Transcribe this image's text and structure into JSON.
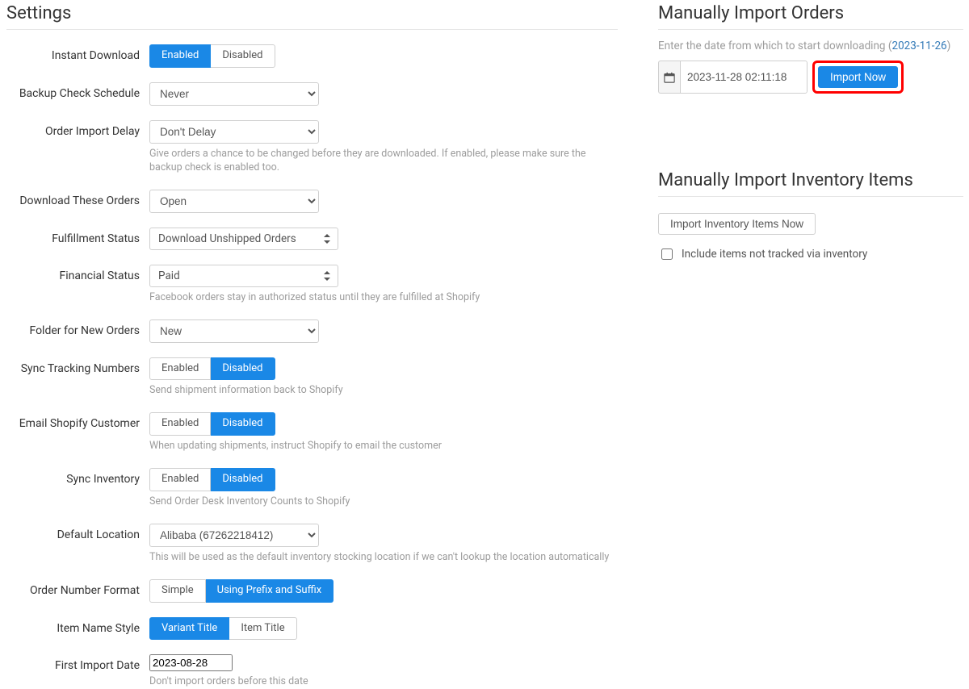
{
  "left": {
    "heading": "Settings",
    "rows": {
      "instant_download": {
        "label": "Instant Download",
        "options": [
          "Enabled",
          "Disabled"
        ],
        "active": 0
      },
      "backup_check": {
        "label": "Backup Check Schedule",
        "value": "Never"
      },
      "order_import_delay": {
        "label": "Order Import Delay",
        "value": "Don't Delay",
        "help": "Give orders a chance to be changed before they are downloaded. If enabled, please make sure the backup check is enabled too."
      },
      "download_these": {
        "label": "Download These Orders",
        "value": "Open"
      },
      "fulfillment": {
        "label": "Fulfillment Status",
        "value": "Download Unshipped Orders"
      },
      "financial": {
        "label": "Financial Status",
        "value": "Paid",
        "help": "Facebook orders stay in authorized status until they are fulfilled at Shopify"
      },
      "folder_new": {
        "label": "Folder for New Orders",
        "value": "New"
      },
      "sync_tracking": {
        "label": "Sync Tracking Numbers",
        "options": [
          "Enabled",
          "Disabled"
        ],
        "active": 1,
        "help": "Send shipment information back to Shopify"
      },
      "email_customer": {
        "label": "Email Shopify Customer",
        "options": [
          "Enabled",
          "Disabled"
        ],
        "active": 1,
        "help": "When updating shipments, instruct Shopify to email the customer"
      },
      "sync_inventory": {
        "label": "Sync Inventory",
        "options": [
          "Enabled",
          "Disabled"
        ],
        "active": 1,
        "help": "Send Order Desk Inventory Counts to Shopify"
      },
      "default_location": {
        "label": "Default Location",
        "value": "Alibaba (67262218412)",
        "help": "This will be used as the default inventory stocking location if we can't lookup the location automatically"
      },
      "order_number_format": {
        "label": "Order Number Format",
        "options": [
          "Simple",
          "Using Prefix and Suffix"
        ],
        "active": 1
      },
      "item_name_style": {
        "label": "Item Name Style",
        "options": [
          "Variant Title",
          "Item Title"
        ],
        "active": 0
      },
      "first_import_date": {
        "label": "First Import Date",
        "value": "2023-08-28",
        "help": "Don't import orders before this date"
      }
    }
  },
  "right": {
    "import_orders": {
      "heading": "Manually Import Orders",
      "desc_prefix": "Enter the date from which to start downloading (",
      "desc_link": "2023-11-26",
      "desc_suffix": ")",
      "date_value": "2023-11-28 02:11:18",
      "button": "Import Now"
    },
    "import_inventory": {
      "heading": "Manually Import Inventory Items",
      "button": "Import Inventory Items Now",
      "checkbox_label": "Include items not tracked via inventory"
    }
  }
}
